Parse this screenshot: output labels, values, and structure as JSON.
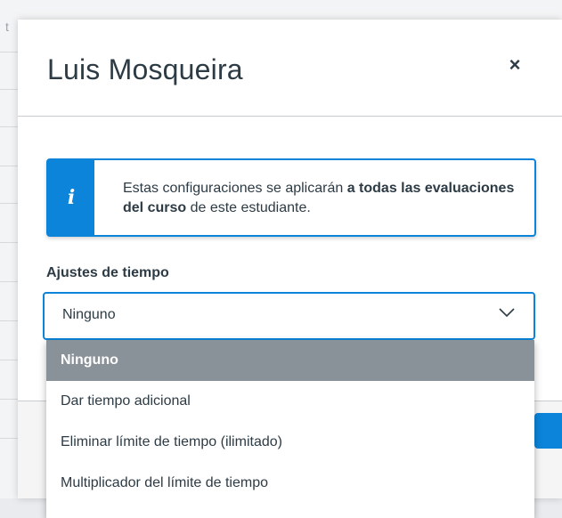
{
  "modal": {
    "title": "Luis Mosqueira",
    "close_symbol": "×"
  },
  "alert": {
    "icon": "i",
    "text_start": "Estas configuraciones se aplicarán ",
    "text_bold": "a todas las evaluaciones del curso",
    "text_end": " de este estudiante."
  },
  "time_settings": {
    "label": "Ajustes de tiempo",
    "selected_value": "Ninguno",
    "options": [
      "Ninguno",
      "Dar tiempo adicional",
      "Eliminar límite de tiempo (ilimitado)",
      "Multiplicador del límite de tiempo"
    ]
  },
  "background": {
    "partial_letter": "t"
  },
  "colors": {
    "accent": "#0b84d9",
    "selected_option": "#8a9299",
    "text": "#2d3b45"
  },
  "icons": {
    "close": "close-icon",
    "info": "info-icon",
    "chevron": "chevron-down-icon"
  }
}
